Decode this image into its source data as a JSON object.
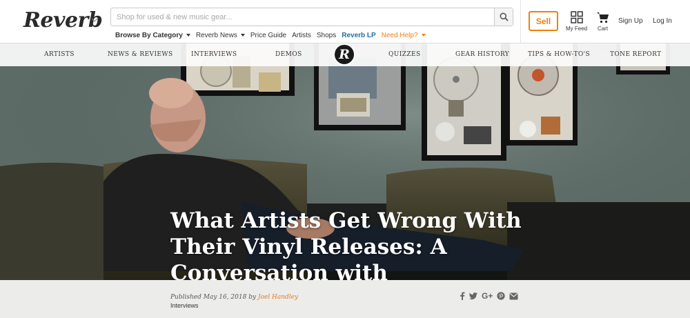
{
  "header": {
    "logo_text": "Reverb",
    "search_placeholder": "Shop for used & new music gear...",
    "subnav": {
      "browse": "Browse By Category",
      "news": "Reverb News",
      "price_guide": "Price Guide",
      "artists": "Artists",
      "shops": "Shops",
      "reverb_lp": "Reverb LP",
      "help": "Need Help?"
    },
    "sell": "Sell",
    "my_feed": "My Feed",
    "cart": "Cart",
    "sign_up": "Sign Up",
    "log_in": "Log In"
  },
  "catnav": {
    "items": [
      "ARTISTS",
      "NEWS & REVIEWS",
      "INTERVIEWS",
      "DEMOS",
      "QUIZZES",
      "GEAR HISTORY",
      "TIPS & HOW-TO'S",
      "TONE REPORT"
    ],
    "badge": "R"
  },
  "article": {
    "title": "What Artists Get Wrong With Their Vinyl Releases: A Conversation with Masterdisk’s Scott Hull",
    "published_prefix": "Published May 16, 2018 by",
    "author": "Joel Handley",
    "category": "Interviews"
  },
  "share_icons": [
    "facebook-icon",
    "twitter-icon",
    "google-plus-icon",
    "pinterest-icon",
    "email-icon"
  ],
  "colors": {
    "accent": "#f07f0c",
    "link_blue": "#1f6fa8",
    "author": "#e07b1f"
  }
}
